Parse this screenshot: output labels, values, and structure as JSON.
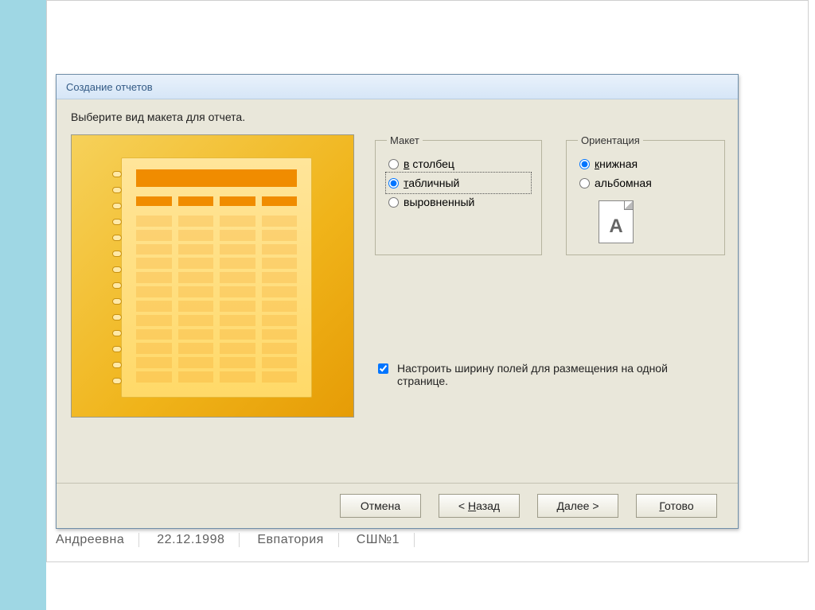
{
  "background": {
    "datasheet_cells": [
      "Андреевна",
      "22.12.1998",
      "Евпатория",
      "СШ№1"
    ]
  },
  "dialog": {
    "title": "Создание отчетов",
    "instruction": "Выберите вид макета для отчета.",
    "layout_group": {
      "legend": "Макет",
      "options": {
        "columnar": "в столбец",
        "tabular": "табличный",
        "justified": "выровненный"
      },
      "selected": "tabular"
    },
    "orientation_group": {
      "legend": "Ориентация",
      "options": {
        "portrait": "книжная",
        "landscape": "альбомная"
      },
      "selected": "portrait",
      "icon_letter": "A"
    },
    "fit_checkbox": {
      "label": "Настроить ширину полей для размещения на одной странице.",
      "checked": true
    },
    "buttons": {
      "cancel": "Отмена",
      "back": "< Назад",
      "next": "Далее >",
      "finish": "Готово"
    }
  }
}
